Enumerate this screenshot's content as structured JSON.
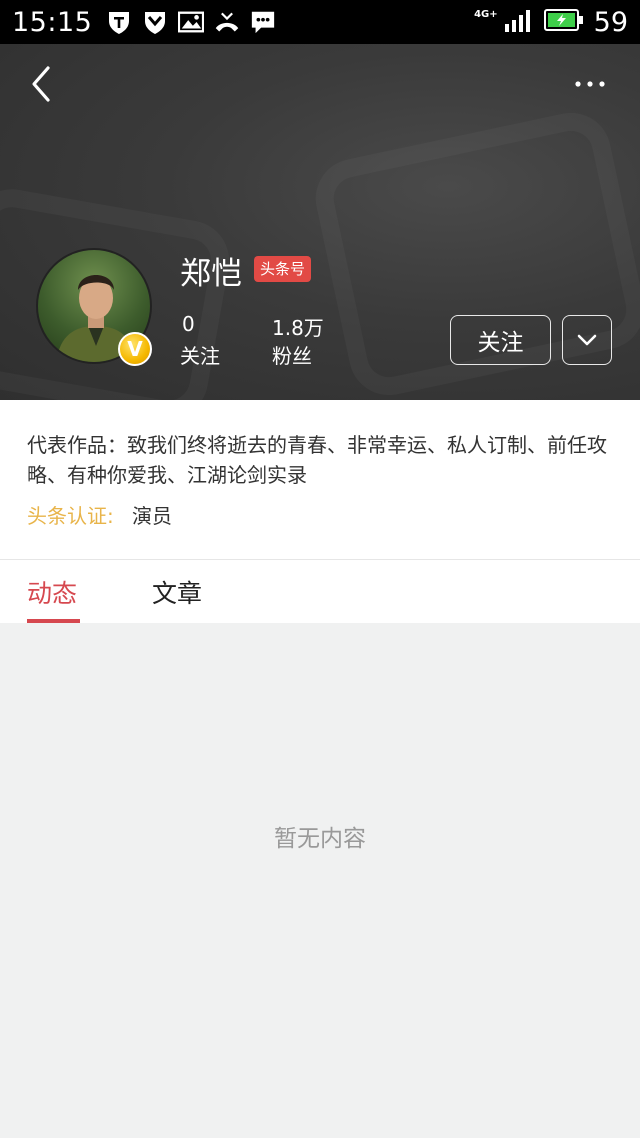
{
  "status_bar": {
    "time": "15:15",
    "network": "4G+",
    "battery": "59",
    "icons": [
      "shield-t-icon",
      "vpn-check-icon",
      "image-icon",
      "missed-call-icon",
      "message-icon"
    ]
  },
  "header": {
    "back_icon": "chevron-left-icon",
    "more_icon": "more-dots-icon",
    "name": "郑恺",
    "tag": "头条号",
    "badge": "V",
    "stats": [
      {
        "value": "0",
        "label": "关注"
      },
      {
        "value": "1.8万",
        "label": "粉丝"
      }
    ],
    "follow_label": "关注",
    "dropdown_icon": "chevron-down-icon"
  },
  "info": {
    "works": "代表作品：致我们终将逝去的青春、非常幸运、私人订制、前任攻略、有种你爱我、江湖论剑实录",
    "cert_label": "头条认证:",
    "cert_value": "演员"
  },
  "tabs": [
    {
      "label": "动态",
      "active": true
    },
    {
      "label": "文章",
      "active": false
    }
  ],
  "content": {
    "empty_text": "暂无内容"
  },
  "colors": {
    "accent": "#d6484f",
    "tag_red": "#e24a45",
    "cert_gold": "#e8b44a",
    "header_bg": "#3a3a3a",
    "page_bg": "#f0f1f1"
  }
}
